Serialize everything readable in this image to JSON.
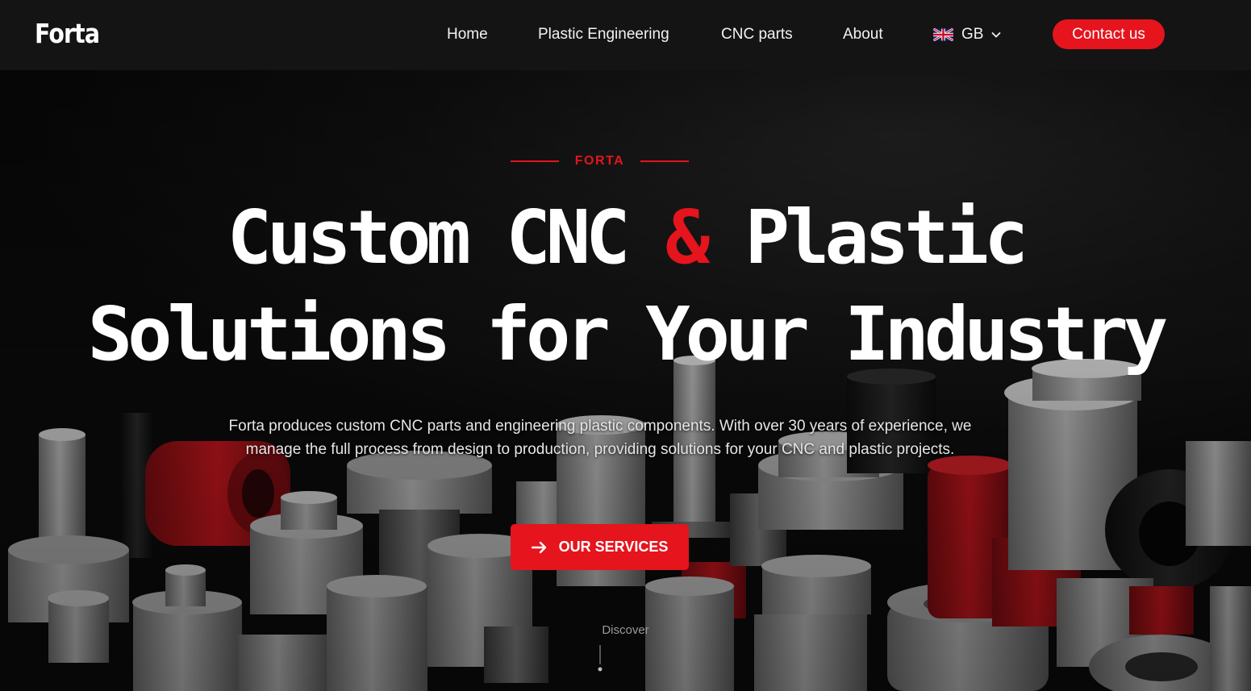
{
  "header": {
    "logo": "Forta",
    "nav": [
      "Home",
      "Plastic Engineering",
      "CNC parts",
      "About"
    ],
    "language": {
      "code": "GB",
      "icon": "uk-flag-icon"
    },
    "contact_label": "Contact us"
  },
  "hero": {
    "eyebrow": "FORTA",
    "headline_line1_a": "Custom CNC",
    "headline_line1_amp": "&",
    "headline_line1_b": "Plastic",
    "headline_line2": "Solutions for Your Industry",
    "description": "Forta produces custom CNC parts and engineering plastic components. With over 30 years of experience, we manage the full process from design to production, providing solutions for your CNC and plastic projects.",
    "cta_label": "OUR SERVICES",
    "cta_icon": "arrow-right-icon",
    "discover_label": "Discover"
  },
  "colors": {
    "accent": "#e5141d",
    "header_bg": "#141414",
    "hero_bg": "#0d0d0d"
  }
}
